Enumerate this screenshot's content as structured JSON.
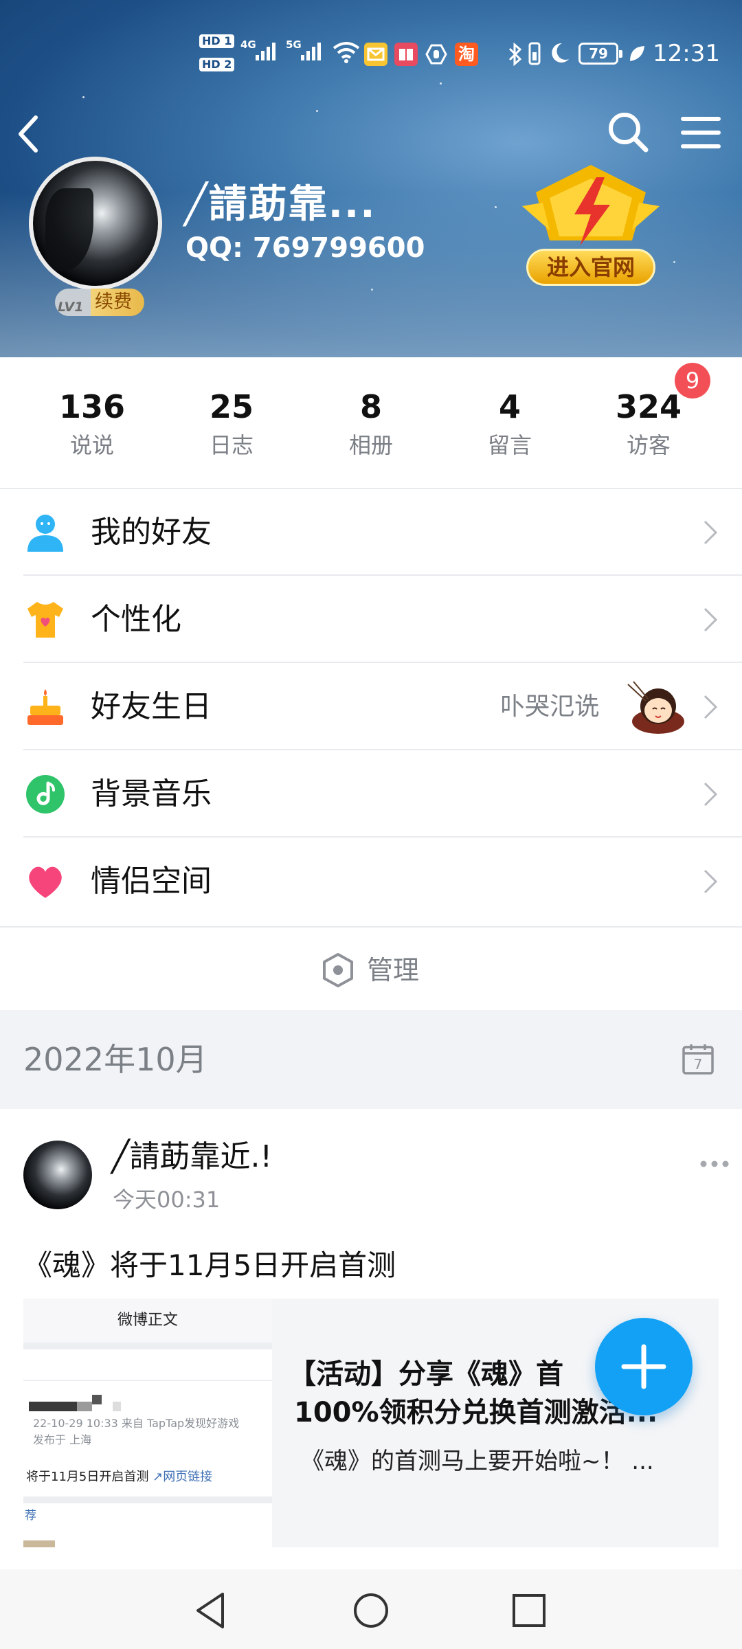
{
  "status_bar": {
    "hd1": "HD 1",
    "hd2": "HD 2",
    "net1": "4G",
    "net2": "5G",
    "battery": "79",
    "time": "12:31",
    "taobao_glyph": "淘"
  },
  "header": {
    "nickname": "╱請莇靠...",
    "qq_line": "QQ: 769799600",
    "level": "LV1",
    "renew_label": "续费",
    "official_label": "进入官网"
  },
  "stats": [
    {
      "value": "136",
      "label": "说说"
    },
    {
      "value": "25",
      "label": "日志"
    },
    {
      "value": "8",
      "label": "相册"
    },
    {
      "value": "4",
      "label": "留言"
    },
    {
      "value": "324",
      "label": "访客"
    }
  ],
  "visitor_badge": "9",
  "menu": [
    {
      "label": "我的好友",
      "icon": "friends-icon"
    },
    {
      "label": "个性化",
      "icon": "tshirt-icon"
    },
    {
      "label": "好友生日",
      "icon": "cake-icon",
      "extra": "卟哭氾诜"
    },
    {
      "label": "背景音乐",
      "icon": "music-icon"
    },
    {
      "label": "情侣空间",
      "icon": "heart-icon"
    }
  ],
  "manage_label": "管理",
  "month_label": "2022年10月",
  "calendar_day": "7",
  "post": {
    "author": "╱請莇靠近.!",
    "time": "今天00:31",
    "text": "《魂》将于11月5日开启首测",
    "card": {
      "thumb_title": "微博正文",
      "thumb_meta1": "22-10-29 10:33  来自 TapTap发现好游戏",
      "thumb_meta2": "发布于 上海",
      "thumb_line": "将于11月5日开启首测",
      "thumb_link": "网页链接",
      "thumb_rec": "荐",
      "title_line1": "【活动】分享《魂》首",
      "title_line2": "100%领积分兑换首测激活...",
      "desc": "《魂》的首测马上要开始啦~！ ..."
    }
  },
  "colors": {
    "accent": "#12a1f5",
    "badge_red": "#f25056",
    "muted_text": "#7b7f86"
  }
}
